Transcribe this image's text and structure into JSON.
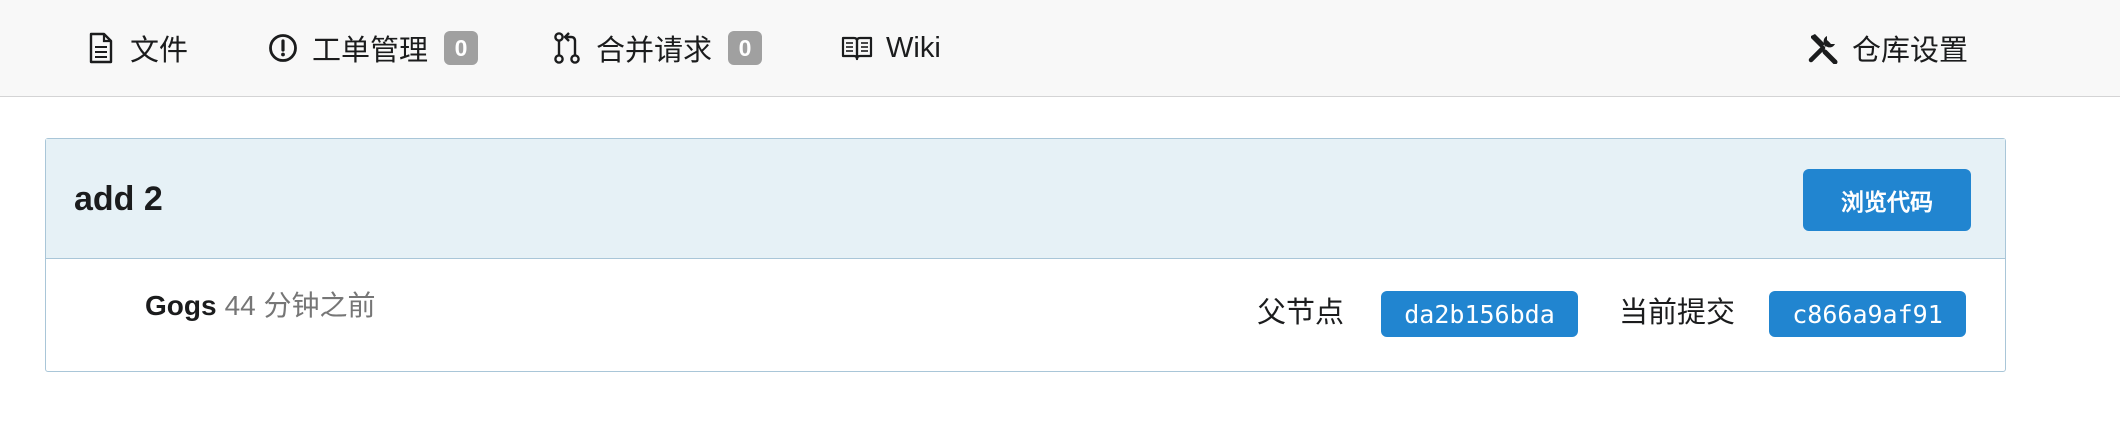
{
  "tabs": {
    "files": {
      "label": "文件",
      "icon": "file-text-icon"
    },
    "issues": {
      "label": "工单管理",
      "count": "0",
      "icon": "issue-opened-icon"
    },
    "pulls": {
      "label": "合并请求",
      "count": "0",
      "icon": "git-pull-request-icon"
    },
    "wiki": {
      "label": "Wiki",
      "icon": "book-icon"
    },
    "settings": {
      "label": "仓库设置",
      "icon": "tools-icon"
    }
  },
  "commit": {
    "title": "add 2",
    "browse_label": "浏览代码",
    "author": "Gogs",
    "time": "44 分钟之前",
    "parent_label": "父节点",
    "parent_sha": "da2b156bda",
    "current_label": "当前提交",
    "current_sha": "c866a9af91"
  },
  "colors": {
    "primary": "#2185d0",
    "badge": "#a0a0a0",
    "header_bg": "#e6f1f6",
    "border": "#a9c6d8"
  }
}
